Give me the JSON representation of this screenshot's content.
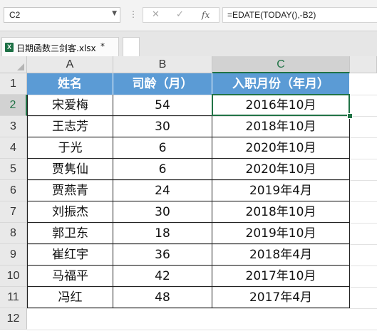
{
  "formula_bar": {
    "name_box": "C2",
    "formula": "=EDATE(TODAY(),-B2)",
    "icons": [
      "chevron-down-icon",
      "cancel-icon",
      "enter-check-icon",
      "fx-icon"
    ]
  },
  "tabs": [
    {
      "label": "日期函数三剑客.xlsx",
      "unsaved_mark": "*"
    }
  ],
  "columns": [
    "A",
    "B",
    "C"
  ],
  "active_column": "C",
  "rows": [
    "1",
    "2",
    "3",
    "4",
    "5",
    "6",
    "7",
    "8",
    "9",
    "10",
    "11",
    "12"
  ],
  "active_row": "2",
  "selected_cell": "C2",
  "table": {
    "headers": [
      "姓名",
      "司龄（月）",
      "入职月份（年月）"
    ],
    "data": [
      [
        "宋爱梅",
        "54",
        "2016年10月"
      ],
      [
        "王志芳",
        "30",
        "2018年10月"
      ],
      [
        "于光",
        "6",
        "2020年10月"
      ],
      [
        "贾隽仙",
        "6",
        "2020年10月"
      ],
      [
        "贾燕青",
        "24",
        "2019年4月"
      ],
      [
        "刘振杰",
        "30",
        "2018年10月"
      ],
      [
        "郭卫东",
        "18",
        "2019年10月"
      ],
      [
        "崔红宇",
        "36",
        "2018年4月"
      ],
      [
        "马福平",
        "42",
        "2017年10月"
      ],
      [
        "冯红",
        "48",
        "2017年4月"
      ]
    ]
  },
  "colors": {
    "header_fill": "#5b9bd5",
    "header_text": "#ffffff",
    "selection": "#217346"
  }
}
